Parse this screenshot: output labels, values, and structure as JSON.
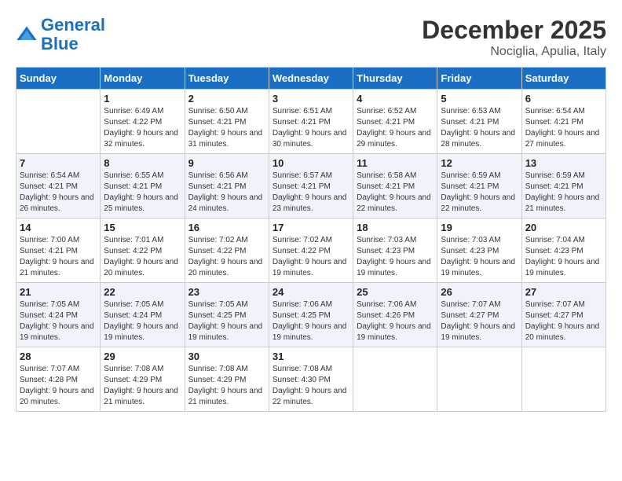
{
  "logo": {
    "line1": "General",
    "line2": "Blue"
  },
  "header": {
    "month": "December 2025",
    "location": "Nociglia, Apulia, Italy"
  },
  "weekdays": [
    "Sunday",
    "Monday",
    "Tuesday",
    "Wednesday",
    "Thursday",
    "Friday",
    "Saturday"
  ],
  "weeks": [
    [
      {
        "day": "",
        "sunrise": "",
        "sunset": "",
        "daylight": ""
      },
      {
        "day": "1",
        "sunrise": "Sunrise: 6:49 AM",
        "sunset": "Sunset: 4:22 PM",
        "daylight": "Daylight: 9 hours and 32 minutes."
      },
      {
        "day": "2",
        "sunrise": "Sunrise: 6:50 AM",
        "sunset": "Sunset: 4:21 PM",
        "daylight": "Daylight: 9 hours and 31 minutes."
      },
      {
        "day": "3",
        "sunrise": "Sunrise: 6:51 AM",
        "sunset": "Sunset: 4:21 PM",
        "daylight": "Daylight: 9 hours and 30 minutes."
      },
      {
        "day": "4",
        "sunrise": "Sunrise: 6:52 AM",
        "sunset": "Sunset: 4:21 PM",
        "daylight": "Daylight: 9 hours and 29 minutes."
      },
      {
        "day": "5",
        "sunrise": "Sunrise: 6:53 AM",
        "sunset": "Sunset: 4:21 PM",
        "daylight": "Daylight: 9 hours and 28 minutes."
      },
      {
        "day": "6",
        "sunrise": "Sunrise: 6:54 AM",
        "sunset": "Sunset: 4:21 PM",
        "daylight": "Daylight: 9 hours and 27 minutes."
      }
    ],
    [
      {
        "day": "7",
        "sunrise": "Sunrise: 6:54 AM",
        "sunset": "Sunset: 4:21 PM",
        "daylight": "Daylight: 9 hours and 26 minutes."
      },
      {
        "day": "8",
        "sunrise": "Sunrise: 6:55 AM",
        "sunset": "Sunset: 4:21 PM",
        "daylight": "Daylight: 9 hours and 25 minutes."
      },
      {
        "day": "9",
        "sunrise": "Sunrise: 6:56 AM",
        "sunset": "Sunset: 4:21 PM",
        "daylight": "Daylight: 9 hours and 24 minutes."
      },
      {
        "day": "10",
        "sunrise": "Sunrise: 6:57 AM",
        "sunset": "Sunset: 4:21 PM",
        "daylight": "Daylight: 9 hours and 23 minutes."
      },
      {
        "day": "11",
        "sunrise": "Sunrise: 6:58 AM",
        "sunset": "Sunset: 4:21 PM",
        "daylight": "Daylight: 9 hours and 22 minutes."
      },
      {
        "day": "12",
        "sunrise": "Sunrise: 6:59 AM",
        "sunset": "Sunset: 4:21 PM",
        "daylight": "Daylight: 9 hours and 22 minutes."
      },
      {
        "day": "13",
        "sunrise": "Sunrise: 6:59 AM",
        "sunset": "Sunset: 4:21 PM",
        "daylight": "Daylight: 9 hours and 21 minutes."
      }
    ],
    [
      {
        "day": "14",
        "sunrise": "Sunrise: 7:00 AM",
        "sunset": "Sunset: 4:21 PM",
        "daylight": "Daylight: 9 hours and 21 minutes."
      },
      {
        "day": "15",
        "sunrise": "Sunrise: 7:01 AM",
        "sunset": "Sunset: 4:22 PM",
        "daylight": "Daylight: 9 hours and 20 minutes."
      },
      {
        "day": "16",
        "sunrise": "Sunrise: 7:02 AM",
        "sunset": "Sunset: 4:22 PM",
        "daylight": "Daylight: 9 hours and 20 minutes."
      },
      {
        "day": "17",
        "sunrise": "Sunrise: 7:02 AM",
        "sunset": "Sunset: 4:22 PM",
        "daylight": "Daylight: 9 hours and 19 minutes."
      },
      {
        "day": "18",
        "sunrise": "Sunrise: 7:03 AM",
        "sunset": "Sunset: 4:23 PM",
        "daylight": "Daylight: 9 hours and 19 minutes."
      },
      {
        "day": "19",
        "sunrise": "Sunrise: 7:03 AM",
        "sunset": "Sunset: 4:23 PM",
        "daylight": "Daylight: 9 hours and 19 minutes."
      },
      {
        "day": "20",
        "sunrise": "Sunrise: 7:04 AM",
        "sunset": "Sunset: 4:23 PM",
        "daylight": "Daylight: 9 hours and 19 minutes."
      }
    ],
    [
      {
        "day": "21",
        "sunrise": "Sunrise: 7:05 AM",
        "sunset": "Sunset: 4:24 PM",
        "daylight": "Daylight: 9 hours and 19 minutes."
      },
      {
        "day": "22",
        "sunrise": "Sunrise: 7:05 AM",
        "sunset": "Sunset: 4:24 PM",
        "daylight": "Daylight: 9 hours and 19 minutes."
      },
      {
        "day": "23",
        "sunrise": "Sunrise: 7:05 AM",
        "sunset": "Sunset: 4:25 PM",
        "daylight": "Daylight: 9 hours and 19 minutes."
      },
      {
        "day": "24",
        "sunrise": "Sunrise: 7:06 AM",
        "sunset": "Sunset: 4:25 PM",
        "daylight": "Daylight: 9 hours and 19 minutes."
      },
      {
        "day": "25",
        "sunrise": "Sunrise: 7:06 AM",
        "sunset": "Sunset: 4:26 PM",
        "daylight": "Daylight: 9 hours and 19 minutes."
      },
      {
        "day": "26",
        "sunrise": "Sunrise: 7:07 AM",
        "sunset": "Sunset: 4:27 PM",
        "daylight": "Daylight: 9 hours and 19 minutes."
      },
      {
        "day": "27",
        "sunrise": "Sunrise: 7:07 AM",
        "sunset": "Sunset: 4:27 PM",
        "daylight": "Daylight: 9 hours and 20 minutes."
      }
    ],
    [
      {
        "day": "28",
        "sunrise": "Sunrise: 7:07 AM",
        "sunset": "Sunset: 4:28 PM",
        "daylight": "Daylight: 9 hours and 20 minutes."
      },
      {
        "day": "29",
        "sunrise": "Sunrise: 7:08 AM",
        "sunset": "Sunset: 4:29 PM",
        "daylight": "Daylight: 9 hours and 21 minutes."
      },
      {
        "day": "30",
        "sunrise": "Sunrise: 7:08 AM",
        "sunset": "Sunset: 4:29 PM",
        "daylight": "Daylight: 9 hours and 21 minutes."
      },
      {
        "day": "31",
        "sunrise": "Sunrise: 7:08 AM",
        "sunset": "Sunset: 4:30 PM",
        "daylight": "Daylight: 9 hours and 22 minutes."
      },
      {
        "day": "",
        "sunrise": "",
        "sunset": "",
        "daylight": ""
      },
      {
        "day": "",
        "sunrise": "",
        "sunset": "",
        "daylight": ""
      },
      {
        "day": "",
        "sunrise": "",
        "sunset": "",
        "daylight": ""
      }
    ]
  ]
}
